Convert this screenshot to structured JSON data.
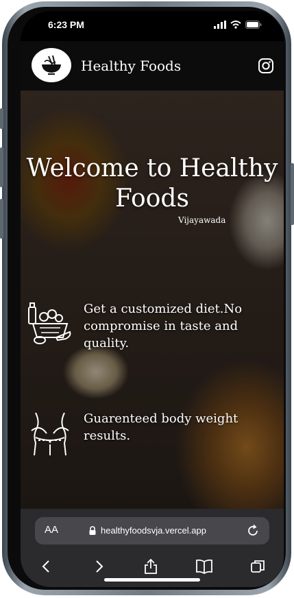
{
  "status_bar": {
    "time": "6:23 PM"
  },
  "header": {
    "brand": "Healthy Foods",
    "logo_icon": "bowl-noodles-icon",
    "social_icon": "instagram-icon"
  },
  "hero": {
    "title": "Welcome to Healthy Foods",
    "subtitle": "Vijayawada",
    "features": [
      {
        "icon": "vegetable-basket-icon",
        "text": "Get a customized diet.No compromise in taste and quality."
      },
      {
        "icon": "body-waist-icon",
        "text": "Guarenteed body weight results."
      }
    ]
  },
  "browser": {
    "text_size_label": "AA",
    "url": "healthyfoodsvja.vercel.app"
  },
  "colors": {
    "header_bg": "#0c0c0c",
    "text": "#ffffff",
    "toolbar_bg": "#2b2b2e"
  }
}
